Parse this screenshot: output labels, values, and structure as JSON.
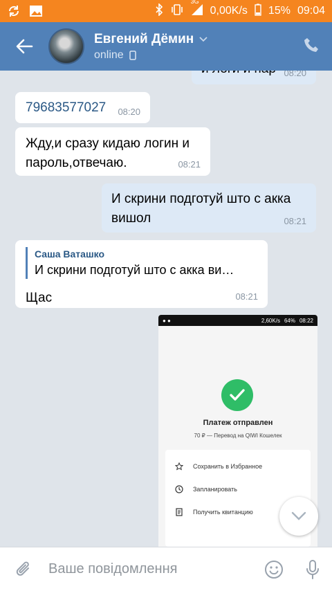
{
  "status_bar": {
    "network": "3G",
    "speed": "0,00K/s",
    "battery": "15%",
    "time": "09:04"
  },
  "header": {
    "name": "Евгений Дёмин",
    "status": "online"
  },
  "messages": {
    "m0": {
      "text": "и логи и пар",
      "time": "08:20"
    },
    "m1": {
      "text": "79683577027",
      "time": "08:20"
    },
    "m2": {
      "line1": "Жду,и сразу кидаю логин и",
      "line2": "пароль,отвечаю.",
      "time": "08:21"
    },
    "m3": {
      "line1": "И скрини подготуй што с акка",
      "line2": "вишол",
      "time": "08:21"
    },
    "m4": {
      "reply_name": "Саша Ваташко",
      "reply_text": "И скрини подготуй што с акка ви…",
      "text": "Щас",
      "time": "08:21"
    }
  },
  "attachment": {
    "status_speed": "2,60K/s",
    "status_battery": "64%",
    "status_time": "08:22",
    "title": "Платеж отправлен",
    "subtitle": "70 ₽ — Перевод на QIWI Кошелек",
    "actions": [
      "Сохранить в Избранное",
      "Запланировать",
      "Получить квитанцию"
    ]
  },
  "composer": {
    "placeholder": "Ваше повідомлення"
  },
  "colors": {
    "status_bar": "#f5851f",
    "header": "#5181b8",
    "chat_bg": "#dfe4ea",
    "outgoing": "#dde9f6",
    "incoming": "#ffffff"
  }
}
